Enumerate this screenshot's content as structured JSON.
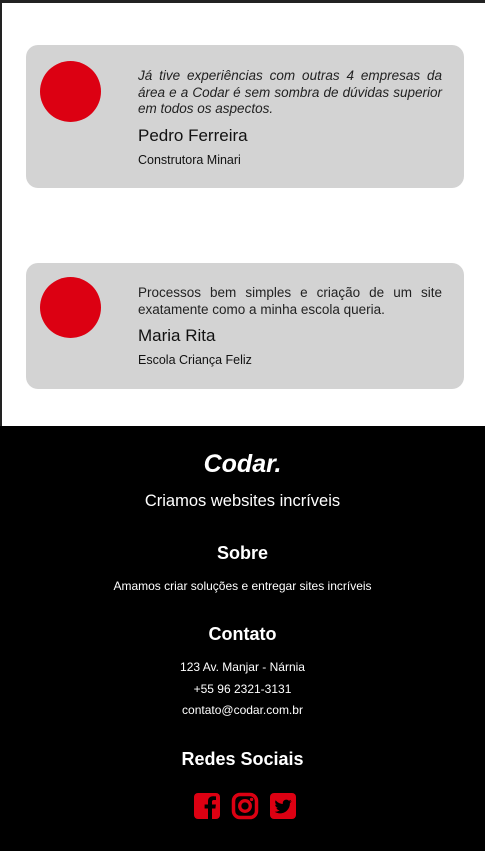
{
  "testimonials": [
    {
      "quote": "Já tive experiências com outras 4 empresas da área e a Codar é sem sombra de dúvidas superior em todos os aspectos.",
      "name": "Pedro Ferreira",
      "company": "Construtora Minari"
    },
    {
      "quote": "Processos bem simples e criação de um site exatamente como a minha escola queria.",
      "name": "Maria Rita",
      "company": "Escola Criança Feliz"
    }
  ],
  "footer": {
    "brand": "Codar.",
    "tagline": "Criamos websites incríveis",
    "sobre": {
      "title": "Sobre",
      "text": "Amamos criar soluções e entregar sites incríveis"
    },
    "contato": {
      "title": "Contato",
      "lines": [
        "123 Av. Manjar - Nárnia",
        "+55 96 2321-3131",
        "contato@codar.com.br"
      ]
    },
    "redes": {
      "title": "Redes Sociais",
      "icons": [
        "facebook-icon",
        "instagram-icon",
        "twitter-icon"
      ]
    }
  },
  "colors": {
    "accent": "#dc0012",
    "card_bg": "#d3d3d3",
    "footer_bg": "#000000"
  }
}
